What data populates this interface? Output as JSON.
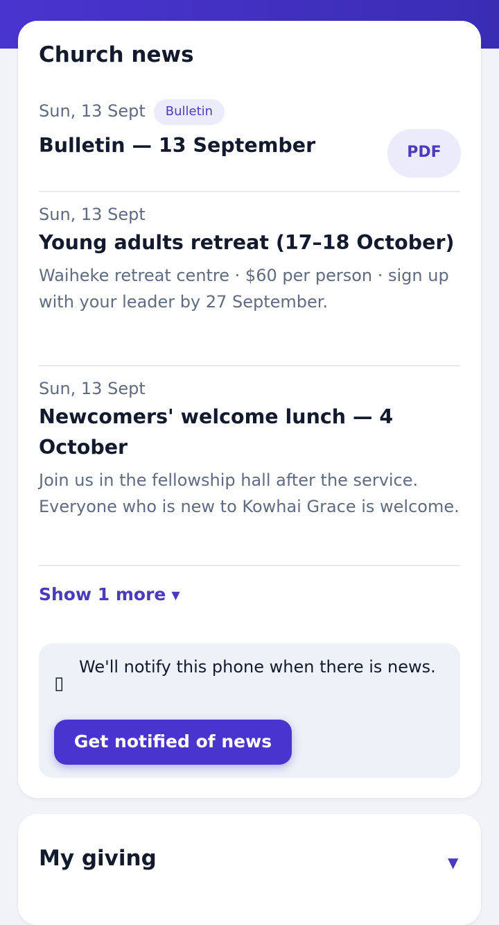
{
  "news": {
    "title": "Church news",
    "items": [
      {
        "date": "Sun, 13 Sept",
        "badge": "Bulletin",
        "title": "Bulletin — 13 September",
        "action": "PDF"
      },
      {
        "date": "Sun, 13 Sept",
        "title": "Young adults retreat (17–18 October)",
        "description": "Waiheke retreat centre · $60 per person · sign up with your leader by 27 September."
      },
      {
        "date": "Sun, 13 Sept",
        "title": "Newcomers' welcome lunch — 4 October",
        "description": "Join us in the fellowship hall after the service. Everyone who is new to Kowhai Grace is welcome."
      }
    ],
    "show_more": "Show 1 more",
    "show_more_icon": "chevron-down-icon",
    "notify": {
      "icon": "phone-icon",
      "text": "We'll notify this phone when there is news.",
      "button": "Get notified of news"
    }
  },
  "giving": {
    "title": "My giving",
    "icon": "chevron-down-icon"
  },
  "colors": {
    "accent": "#4a34cf",
    "accent_text": "#4a3bbd",
    "badge_bg": "#ecebfb",
    "muted_text": "#606a80",
    "page_bg": "#f1f3f8"
  }
}
